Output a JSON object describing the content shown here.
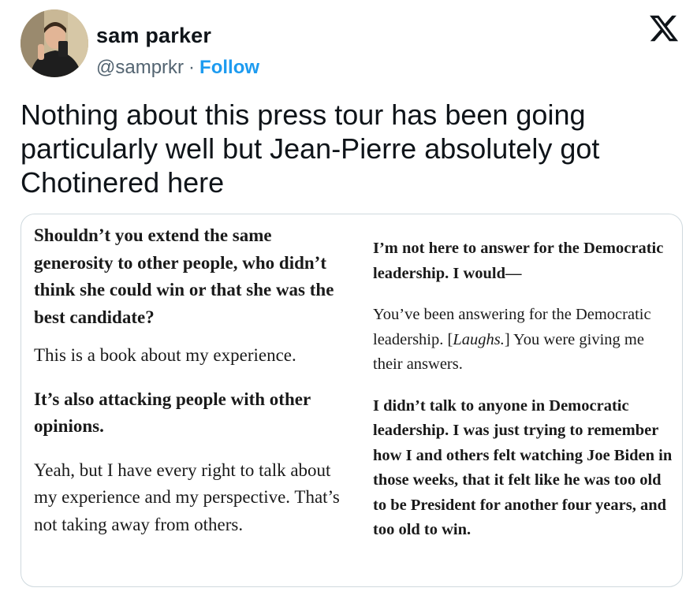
{
  "author": {
    "name": "sam parker",
    "handle": "@samprkr",
    "separator": "·",
    "follow_label": "Follow"
  },
  "tweet": {
    "text": "Nothing about this press tour has been going particularly well but Jean-Pierre absolutely got Chotinered here"
  },
  "brand": {
    "logo": "x-logo-icon"
  },
  "excerpt": {
    "left": [
      {
        "kind": "q",
        "text": "Shouldn’t you extend the same generosity to other people, who didn’t think she could win or that she was the best candidate?"
      },
      {
        "kind": "a",
        "text": "This is a book about my experience."
      },
      {
        "kind": "q",
        "text": "It’s also attacking people with other opinions."
      },
      {
        "kind": "a",
        "text": "Yeah, but I have every right to talk about my experience and my perspective. That’s not taking away from others."
      }
    ],
    "right": [
      {
        "kind": "q",
        "text": "I’m not here to answer for the Democratic leadership. I would—"
      },
      {
        "kind": "a",
        "text": "You’ve been answering for the Democratic leadership.",
        "italic": "Laughs.",
        "tail": "You were giving me their answers."
      },
      {
        "kind": "q",
        "text": "I didn’t talk to anyone in Democratic leadership. I was just trying to remember how I and others felt watching Joe Biden in those weeks, that it felt like he was too old to be President for another four years, and too old to win."
      }
    ]
  },
  "colors": {
    "accent": "#1d9bf0",
    "handle": "#536471",
    "text": "#0f1419",
    "border": "#cfd9de"
  }
}
